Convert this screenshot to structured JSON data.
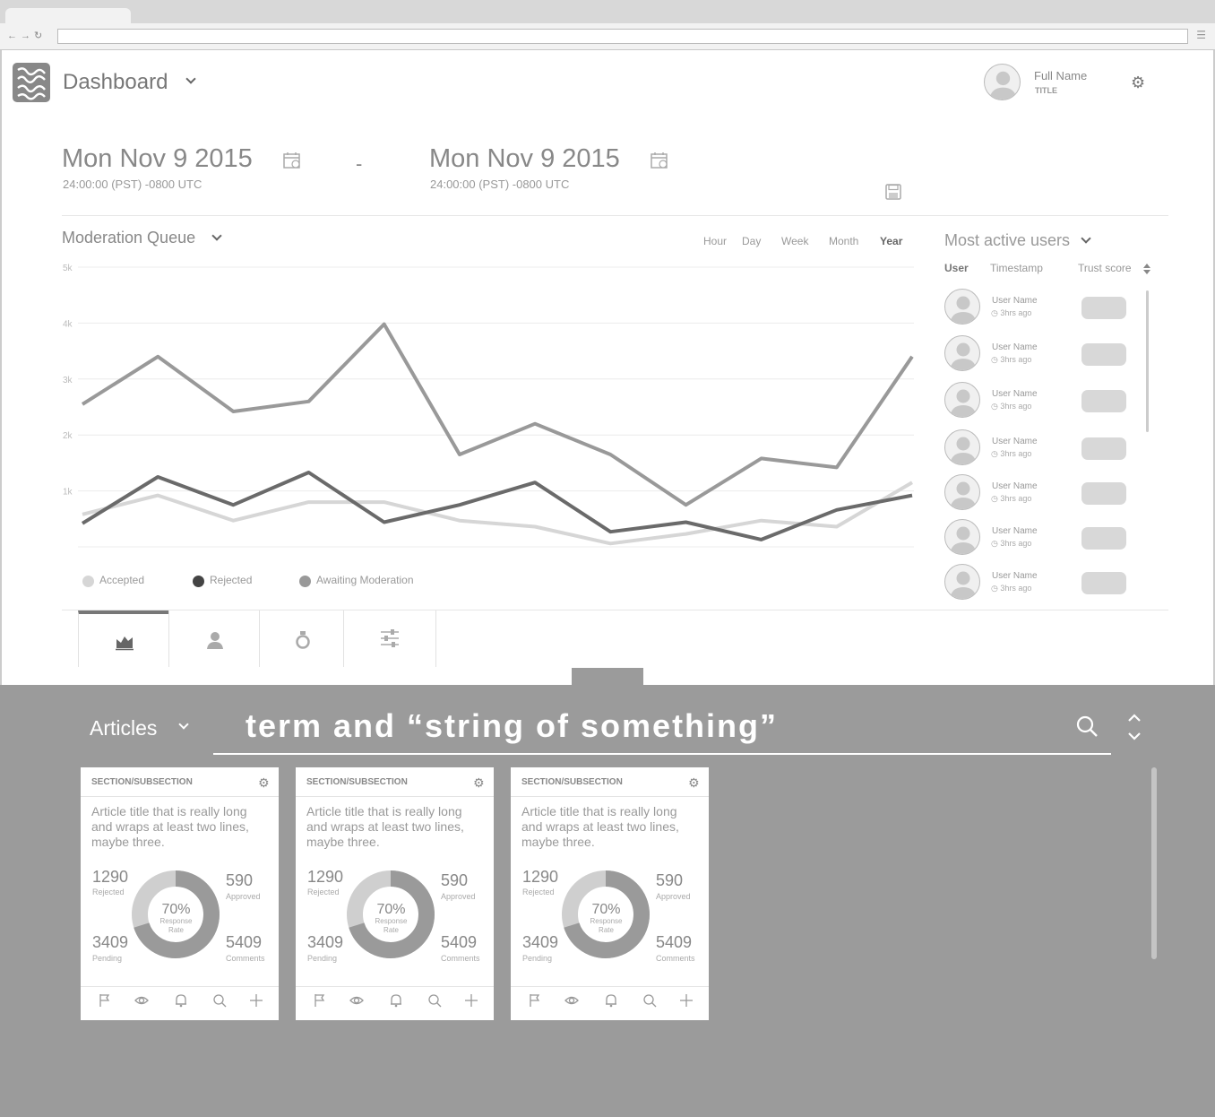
{
  "header": {
    "title": "Dashboard",
    "user_name": "Full Name",
    "user_title": "TITLE"
  },
  "dates": {
    "start_date": "Mon Nov 9 2015",
    "start_time": "24:00:00 (PST) -0800 UTC",
    "separator": "-",
    "end_date": "Mon Nov 9 2015",
    "end_time": "24:00:00 (PST) -0800 UTC"
  },
  "queue": {
    "title": "Moderation Queue",
    "ranges": [
      "Hour",
      "Day",
      "Week",
      "Month",
      "Year"
    ],
    "active_range": "Year"
  },
  "chart_data": {
    "type": "line",
    "x": [
      1,
      2,
      3,
      4,
      5,
      6,
      7,
      8,
      9,
      10,
      11,
      12
    ],
    "ylim": [
      0,
      5000
    ],
    "yticks": [
      1000,
      2000,
      3000,
      4000,
      5000
    ],
    "ytick_labels": [
      "1k",
      "2k",
      "3k",
      "4k",
      "5k"
    ],
    "grid": true,
    "legend_position": "bottom-left",
    "series": [
      {
        "name": "Accepted",
        "color": "#d6d6d6",
        "values": [
          580,
          920,
          470,
          800,
          800,
          470,
          360,
          60,
          230,
          470,
          360,
          1150
        ]
      },
      {
        "name": "Rejected",
        "color": "#6a6a6a",
        "values": [
          420,
          1250,
          750,
          1330,
          440,
          750,
          1150,
          270,
          440,
          130,
          660,
          920
        ]
      },
      {
        "name": "Awaiting Moderation",
        "color": "#999999",
        "values": [
          2550,
          3400,
          2420,
          2600,
          3980,
          1650,
          2200,
          1650,
          750,
          1580,
          1420,
          3400
        ]
      }
    ]
  },
  "most_active": {
    "title": "Most active users",
    "columns": [
      "User",
      "Timestamp",
      "Trust score"
    ],
    "rows": [
      {
        "name": "User Name",
        "time": "3hrs ago"
      },
      {
        "name": "User Name",
        "time": "3hrs ago"
      },
      {
        "name": "User Name",
        "time": "3hrs ago"
      },
      {
        "name": "User Name",
        "time": "3hrs ago"
      },
      {
        "name": "User Name",
        "time": "3hrs ago"
      },
      {
        "name": "User Name",
        "time": "3hrs ago"
      },
      {
        "name": "User Name",
        "time": "3hrs ago"
      }
    ]
  },
  "tool_tabs": [
    "area-chart-icon",
    "user-icon",
    "flask-icon",
    "sliders-icon"
  ],
  "articles": {
    "label": "Articles",
    "search_term": "term and “string of something”",
    "cards": [
      {
        "section": "SECTION/SUBSECTION",
        "title": "Article title that is really long and wraps at least two lines, maybe three.",
        "rejected": "1290",
        "rejected_label": "Rejected",
        "approved": "590",
        "approved_label": "Approved",
        "pending": "3409",
        "pending_label": "Pending",
        "comments": "5409",
        "comments_label": "Comments",
        "percent": "70%",
        "percent_label_1": "Response",
        "percent_label_2": "Rate",
        "response_rate": 0.7
      },
      {
        "section": "SECTION/SUBSECTION",
        "title": "Article title that is really long and wraps at least two lines, maybe three.",
        "rejected": "1290",
        "rejected_label": "Rejected",
        "approved": "590",
        "approved_label": "Approved",
        "pending": "3409",
        "pending_label": "Pending",
        "comments": "5409",
        "comments_label": "Comments",
        "percent": "70%",
        "percent_label_1": "Response",
        "percent_label_2": "Rate",
        "response_rate": 0.7
      },
      {
        "section": "SECTION/SUBSECTION",
        "title": "Article title that is really long and wraps at least two lines, maybe three.",
        "rejected": "1290",
        "rejected_label": "Rejected",
        "approved": "590",
        "approved_label": "Approved",
        "pending": "3409",
        "pending_label": "Pending",
        "comments": "5409",
        "comments_label": "Comments",
        "percent": "70%",
        "percent_label_1": "Response",
        "percent_label_2": "Rate",
        "response_rate": 0.7
      }
    ]
  }
}
